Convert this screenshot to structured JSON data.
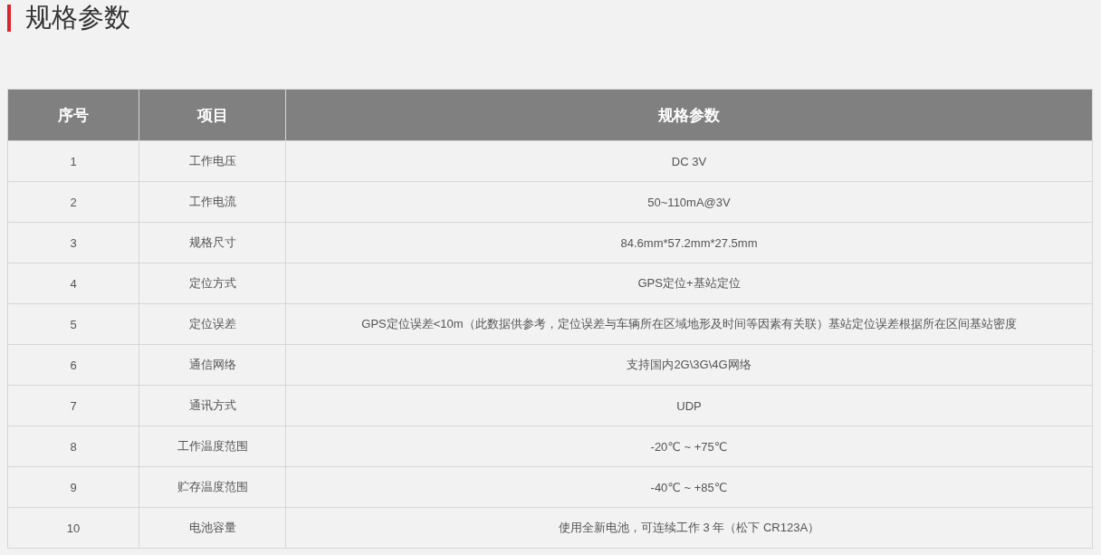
{
  "title": "规格参数",
  "table": {
    "columns": [
      "序号",
      "项目",
      "规格参数"
    ],
    "rows": [
      [
        "1",
        "工作电压",
        "DC 3V"
      ],
      [
        "2",
        "工作电流",
        "50~110mA@3V"
      ],
      [
        "3",
        "规格尺寸",
        "84.6mm*57.2mm*27.5mm"
      ],
      [
        "4",
        "定位方式",
        "GPS定位+基站定位"
      ],
      [
        "5",
        "定位误差",
        "GPS定位误差<10m（此数据供参考，定位误差与车辆所在区域地形及时间等因素有关联）基站定位误差根据所在区间基站密度"
      ],
      [
        "6",
        "通信网络",
        "支持国内2G\\3G\\4G网络"
      ],
      [
        "7",
        "通讯方式",
        "UDP"
      ],
      [
        "8",
        "工作温度范围",
        "-20℃ ~ +75℃"
      ],
      [
        "9",
        "贮存温度范围",
        "-40℃ ~ +85℃"
      ],
      [
        "10",
        "电池容量",
        "使用全新电池，可连续工作 3 年（松下 CR123A）"
      ]
    ]
  }
}
